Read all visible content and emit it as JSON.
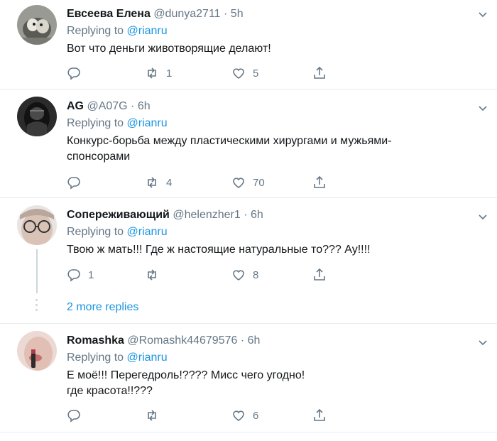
{
  "replies": [
    {
      "name": "Евсеева Елена",
      "handle": "@dunya2711",
      "sep": "·",
      "time": "5h",
      "replying_label": "Replying to",
      "mention": "@rianru",
      "text_lines": [
        "Вот что деньги животворящие делают!"
      ],
      "counts": {
        "reply": "",
        "retweet": "1",
        "like": "5"
      }
    },
    {
      "name": "AG",
      "handle": "@A07G",
      "sep": "·",
      "time": "6h",
      "replying_label": "Replying to",
      "mention": "@rianru",
      "text_lines": [
        "Конкурс-борьба между пластическими хирургами и мужьями-",
        "спонсорами"
      ],
      "counts": {
        "reply": "",
        "retweet": "4",
        "like": "70"
      }
    },
    {
      "name": "Сопереживающий",
      "handle": "@helenzher1",
      "sep": "·",
      "time": "6h",
      "replying_label": "Replying to",
      "mention": "@rianru",
      "text_lines": [
        "Твою ж мать!!! Где ж настоящие натуральные то??? Ау!!!!"
      ],
      "counts": {
        "reply": "1",
        "retweet": "",
        "like": "8"
      }
    },
    {
      "name": "Romashka",
      "handle": "@Romashk44679576",
      "sep": "·",
      "time": "6h",
      "replying_label": "Replying to",
      "mention": "@rianru",
      "text_lines": [
        "Е моё!!!  Перегедроль!???? Мисс чего угодно!",
        "где красота!!???"
      ],
      "counts": {
        "reply": "",
        "retweet": "",
        "like": "6"
      }
    }
  ],
  "more_replies": "2 more replies",
  "colors": {
    "accent": "#1b95e0",
    "muted": "#657786",
    "border": "#e6ecf0"
  }
}
